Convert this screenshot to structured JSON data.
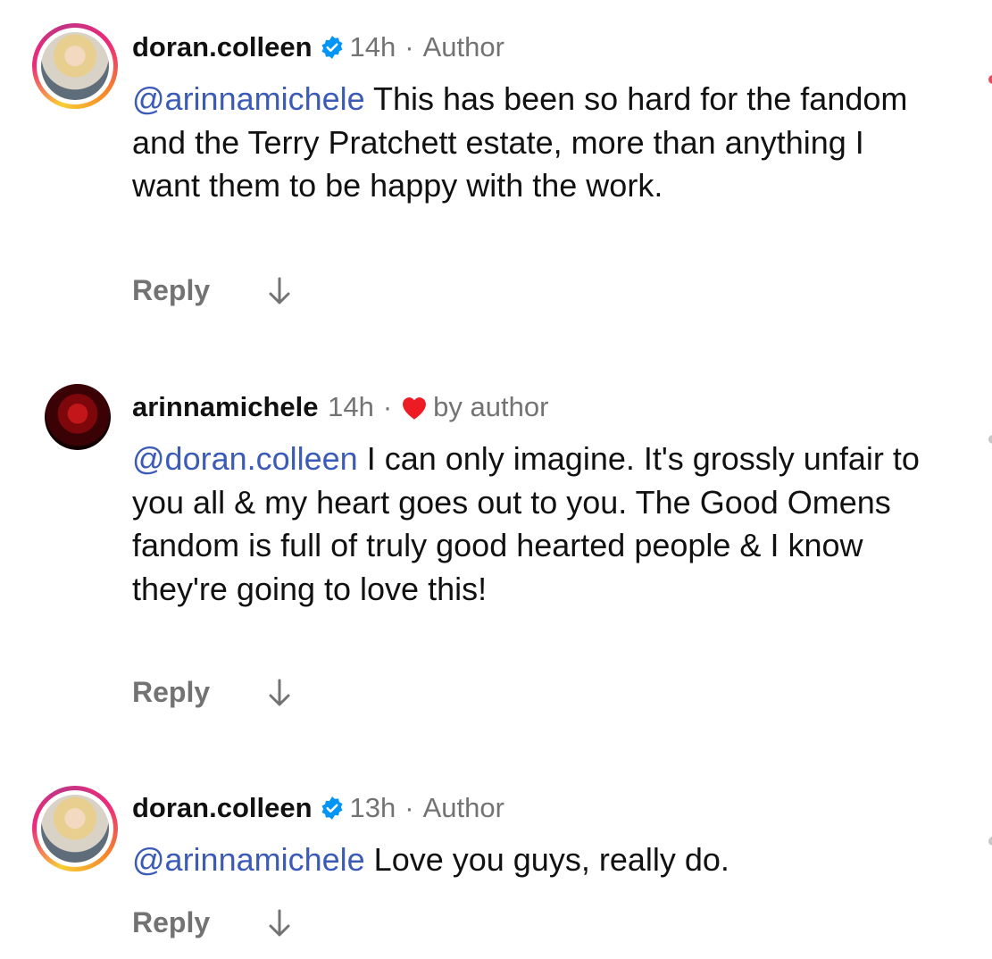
{
  "comments": [
    {
      "username": "doran.colleen",
      "verified": true,
      "time": "14h",
      "separator": "·",
      "tag": "Author",
      "liked_by_author": false,
      "mention": "@arinnamichele",
      "text": " This has been so hard for the fandom and the Terry Pratchett estate, more than anything I want them to be happy with the work.",
      "reply_label": "Reply"
    },
    {
      "username": "arinnamichele",
      "verified": false,
      "time": "14h",
      "separator": "·",
      "tag": "by author",
      "liked_by_author": true,
      "mention": "@doran.colleen",
      "text": " I can only imagine. It's grossly unfair to you all & my heart goes out to you. The Good Omens fandom is full of truly good hearted people & I know they're going to love this!",
      "reply_label": "Reply"
    },
    {
      "username": "doran.colleen",
      "verified": true,
      "time": "13h",
      "separator": "·",
      "tag": "Author",
      "liked_by_author": false,
      "mention": "@arinnamichele",
      "text": " Love you guys, really do.",
      "reply_label": "Reply"
    }
  ],
  "icons": {
    "verified": "verified-badge-icon",
    "heart": "heart-icon",
    "arrow": "arrow-down-icon"
  },
  "colors": {
    "mention": "#3b5bb7",
    "verified": "#0095f6",
    "heart": "#ed1c24",
    "meta": "#737373"
  }
}
